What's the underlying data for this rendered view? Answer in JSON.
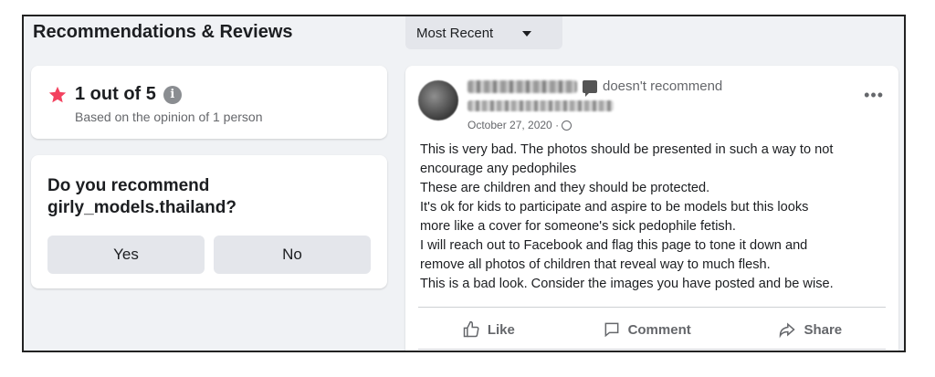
{
  "section": {
    "title": "Recommendations & Reviews",
    "sort_label": "Most Recent"
  },
  "rating": {
    "summary": "1 out of 5",
    "basis": "Based on the opinion of 1 person",
    "star_color": "#f3425f"
  },
  "recommend": {
    "question_line1": "Do you recommend",
    "question_line2": "girly_models.thailand?",
    "yes_label": "Yes",
    "no_label": "No"
  },
  "post": {
    "verb": "doesn't recommend",
    "date": "October 27, 2020 ·",
    "body_lines": [
      "This is very bad. The photos should be presented in such a way to not",
      "encourage any pedophiles",
      "These are children and they should be protected.",
      "It's ok for kids to participate and aspire to be models but this looks",
      "more like a cover for someone's sick pedophile fetish.",
      "I will reach out to Facebook and flag this page to tone it down and",
      "remove all photos of children that reveal way to much flesh.",
      "This is a bad look. Consider the images you have posted and be wise."
    ],
    "actions": {
      "like": "Like",
      "comment": "Comment",
      "share": "Share"
    }
  },
  "icons": {
    "star": "star-icon",
    "info": "info-icon",
    "caret": "caret-down-icon",
    "more": "more-icon",
    "like": "thumbs-up-icon",
    "comment": "comment-icon",
    "share": "share-icon"
  }
}
